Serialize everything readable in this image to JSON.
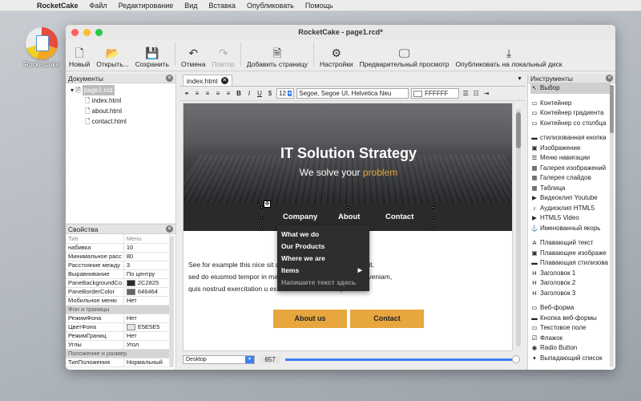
{
  "menubar": {
    "app": "RocketCake",
    "items": [
      "Файл",
      "Редактирование",
      "Вид",
      "Вставка",
      "Опубликовать",
      "Помощь"
    ]
  },
  "desktop": {
    "icon_label": "RocketCake"
  },
  "window": {
    "title": "RocketCake - page1.rcd*"
  },
  "toolbar": {
    "new": "Новый",
    "open": "Открыть...",
    "save": "Сохранить",
    "undo": "Отмена",
    "redo": "Повтор",
    "add_page": "Добавить страницу",
    "settings": "Настройки",
    "preview": "Предварительный просмотр",
    "publish": "Опубликовать на локальный диск"
  },
  "documents": {
    "title": "Документы",
    "root": "page1.rcd",
    "files": [
      "index.html",
      "about.html",
      "contact.html"
    ]
  },
  "properties": {
    "title": "Свойства",
    "header": [
      "Тип",
      "Menu"
    ],
    "rows": [
      [
        "набивка",
        "10"
      ],
      [
        "Минимальное расс",
        "80"
      ],
      [
        "Расстояние между",
        "3"
      ],
      [
        "Выравнивание",
        "По центру"
      ],
      [
        "PaneBackgroundCo",
        "2C2825"
      ],
      [
        "PaneBorderColor",
        "646464"
      ],
      [
        "Мобильное меню",
        "Нет"
      ]
    ],
    "section1": "Фон и границы",
    "rows2": [
      [
        "РежимФона",
        "Нет"
      ],
      [
        "ЦветФона",
        "E5E5E5"
      ],
      [
        "РежимГраниц",
        "Нет"
      ],
      [
        "Углы",
        "Угол"
      ]
    ],
    "section2": "Положение и размер",
    "rows3": [
      [
        "ТипПоложения",
        "Нормальный"
      ]
    ],
    "colors": {
      "pane_bg": "#2C2825",
      "pane_border": "#646464",
      "bg": "#E5E5E5"
    }
  },
  "editor": {
    "tab": "index.html",
    "font_size": "12",
    "font": "Segoe, Segoe UI, Helvetica Neu",
    "color": "FFFFFF",
    "hero_title": "IT Solution Strategy",
    "hero_sub_1": "We solve your ",
    "hero_sub_2": "problem",
    "nav": [
      "Company",
      "About",
      "Contact"
    ],
    "dropdown": [
      "What we do",
      "Our Products",
      "Where we are",
      "Items",
      "Напишите текст здесь"
    ],
    "body_lines": [
      "See for example this nice                              sit amet, consectetur adipiscing elit,",
      "sed do eiusmod tempor in                               magna aliqua. Ut enim ad minim veniam,",
      "quis nostrud exercitation u                            ex ea commodo consequat."
    ],
    "btn_about": "About us",
    "btn_contact": "Contact",
    "view": "Desktop",
    "width": "657",
    "accent": "#E8A63E"
  },
  "tools": {
    "title": "Инструменты",
    "groups": [
      [
        [
          "↖",
          "Выбор"
        ]
      ],
      [
        [
          "▭",
          "Контейнер"
        ],
        [
          "▭",
          "Контейнер градиента"
        ],
        [
          "▭",
          "Контейнер со столбца"
        ]
      ],
      [
        [
          "▬",
          "стилизованная кнопка"
        ],
        [
          "▣",
          "Изображение"
        ],
        [
          "☰",
          "Меню навигации"
        ],
        [
          "▦",
          "Галерея изображений"
        ],
        [
          "▦",
          "Галерея слайдов"
        ],
        [
          "▦",
          "Таблица"
        ],
        [
          "▶",
          "Видеоклип Youtube"
        ],
        [
          "♪",
          "Аудиоклип HTML5"
        ],
        [
          "▶",
          "HTML5 Video"
        ],
        [
          "⚓",
          "Именованный якорь"
        ]
      ],
      [
        [
          "A",
          "Плавающий текст"
        ],
        [
          "▣",
          "Плавающее изображе"
        ],
        [
          "▬",
          "Плавающая стилизова"
        ],
        [
          "H",
          "Заголовок 1"
        ],
        [
          "H",
          "Заголовок 2"
        ],
        [
          "H",
          "Заголовок 3"
        ]
      ],
      [
        [
          "▭",
          "Веб-форма"
        ],
        [
          "▬",
          "Кнопка веб-формы"
        ],
        [
          "▭",
          "Текстовое поле"
        ],
        [
          "☑",
          "Флажок"
        ],
        [
          "◉",
          "Radio Button"
        ],
        [
          "▾",
          "Выпадающий список"
        ]
      ]
    ]
  }
}
